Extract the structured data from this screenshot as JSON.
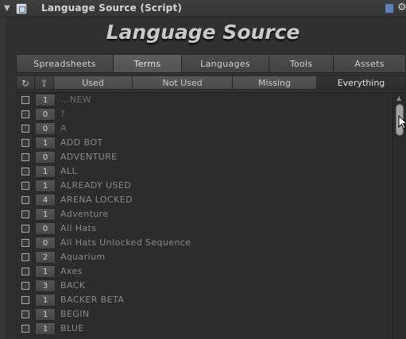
{
  "window": {
    "title": "Language Source (Script)"
  },
  "header": {
    "title": "Language Source"
  },
  "tabs": [
    {
      "label": "Spreadsheets"
    },
    {
      "label": "Terms"
    },
    {
      "label": "Languages"
    },
    {
      "label": "Tools"
    },
    {
      "label": "Assets"
    }
  ],
  "filters": {
    "refresh_icon": "↻",
    "sort_icon": "⇧",
    "items": [
      {
        "label": "Used"
      },
      {
        "label": "Not Used"
      },
      {
        "label": "Missing"
      },
      {
        "label": "Everything"
      }
    ]
  },
  "terms": [
    {
      "count": "1",
      "name": "...NEW"
    },
    {
      "count": "0",
      "name": "?"
    },
    {
      "count": "0",
      "name": "A"
    },
    {
      "count": "1",
      "name": "ADD BOT"
    },
    {
      "count": "0",
      "name": "ADVENTURE"
    },
    {
      "count": "1",
      "name": "ALL"
    },
    {
      "count": "1",
      "name": "ALREADY USED"
    },
    {
      "count": "4",
      "name": "ARENA LOCKED"
    },
    {
      "count": "1",
      "name": "Adventure"
    },
    {
      "count": "0",
      "name": "All Hats"
    },
    {
      "count": "0",
      "name": "All Hats Unlocked Sequence"
    },
    {
      "count": "2",
      "name": "Aquarium"
    },
    {
      "count": "1",
      "name": "Axes"
    },
    {
      "count": "3",
      "name": "BACK"
    },
    {
      "count": "1",
      "name": "BACKER BETA"
    },
    {
      "count": "1",
      "name": "BEGIN"
    },
    {
      "count": "1",
      "name": "BLUE"
    }
  ]
}
